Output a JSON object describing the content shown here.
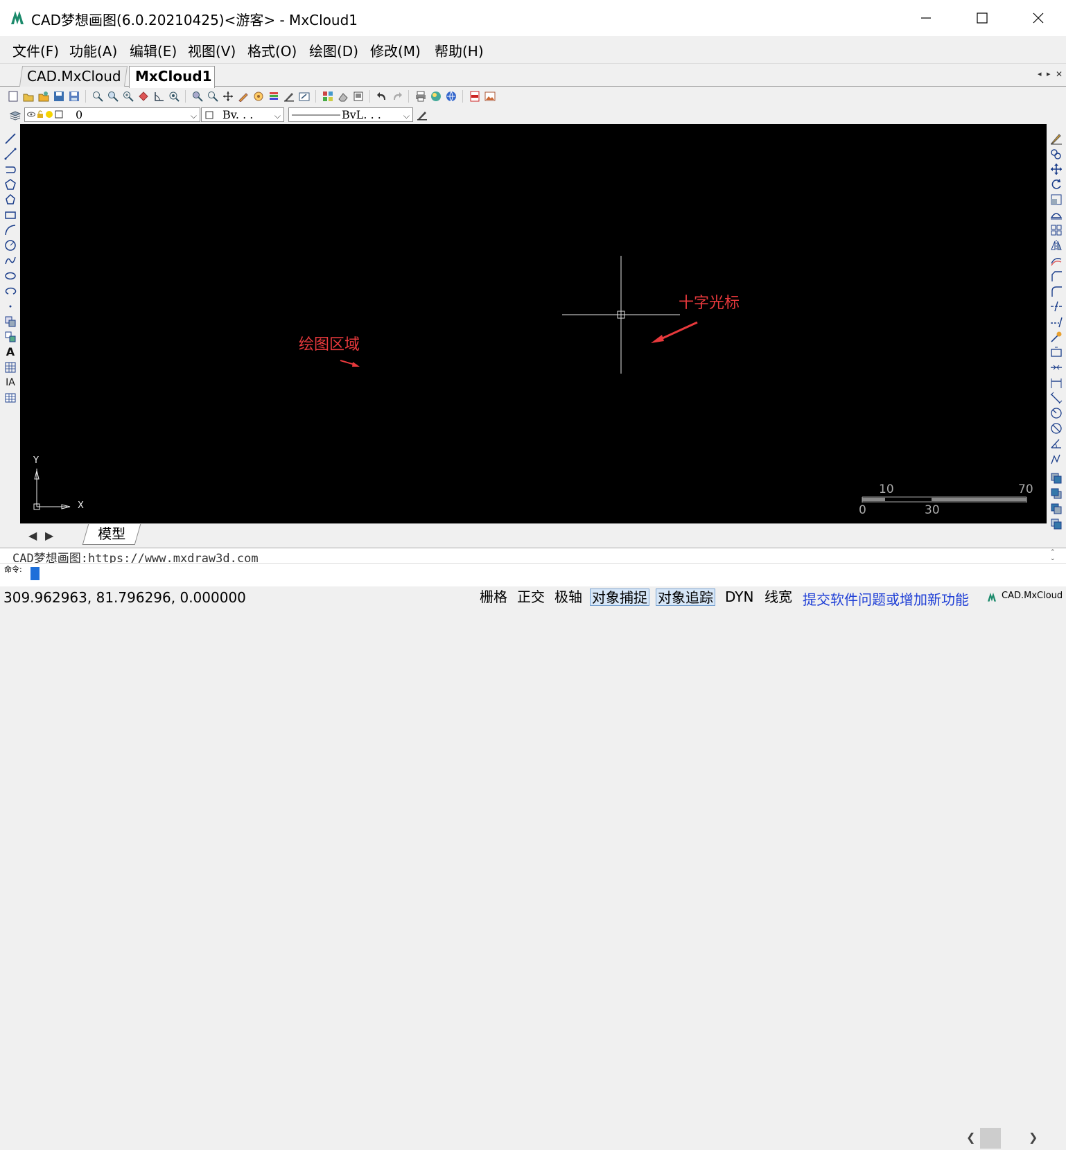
{
  "window": {
    "title": "CAD梦想画图(6.0.20210425)<游客> - MxCloud1",
    "minimize_icon": "minimize-icon",
    "maximize_icon": "maximize-icon",
    "close_icon": "close-icon"
  },
  "menu": {
    "items": [
      "文件(F)",
      "功能(A)",
      "编辑(E)",
      "视图(V)",
      "格式(O)",
      "绘图(D)",
      "修改(M)",
      "帮助(H)"
    ]
  },
  "tabs": {
    "items": [
      {
        "label": "CAD.MxCloud",
        "active": false
      },
      {
        "label": "MxCloud1",
        "active": true
      }
    ]
  },
  "toolbar": {
    "layer_value": "0",
    "color_value": "Bv. . .",
    "linetype_value": "BvL. . ."
  },
  "canvas": {
    "background": "#000000",
    "crosshair_label": "十字光标",
    "drawing_area_label": "绘图区域",
    "annotation_color": "#e8393c",
    "ucs_x_label": "X",
    "ucs_y_label": "Y",
    "scale_ticks": [
      "10",
      "70",
      "0",
      "30"
    ]
  },
  "layout_tabs": {
    "model_label": "模型"
  },
  "command": {
    "history_text": "CAD梦想画图:https://www.mxdraw3d.com",
    "prompt_label": "命令:",
    "input_value": ""
  },
  "status": {
    "coordinates": "309.962963,  81.796296,  0.000000",
    "toggles": [
      {
        "label": "栅格",
        "on": false
      },
      {
        "label": "正交",
        "on": false
      },
      {
        "label": "极轴",
        "on": false
      },
      {
        "label": "对象捕捉",
        "on": true
      },
      {
        "label": "对象追踪",
        "on": true
      },
      {
        "label": "DYN",
        "on": false
      },
      {
        "label": "线宽",
        "on": false
      }
    ],
    "feedback_link": "提交软件问题或增加新功能",
    "brand_label": "CAD.MxCloud"
  }
}
